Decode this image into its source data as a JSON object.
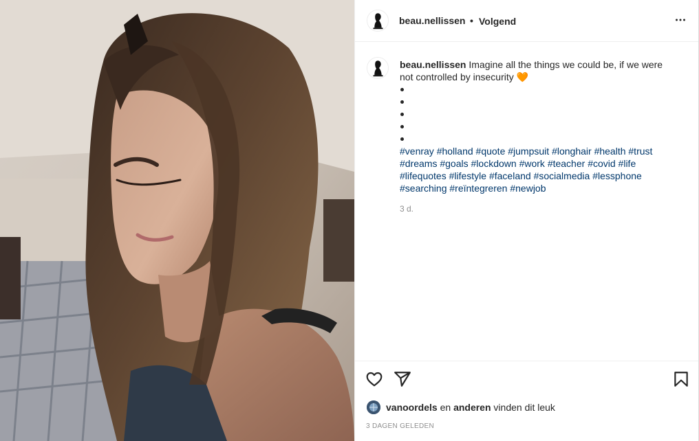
{
  "post": {
    "username": "beau.nellissen",
    "separator": "•",
    "follow_status": "Volgend",
    "photo_icon": "woman-portrait-photo"
  },
  "caption": {
    "username": "beau.nellissen",
    "text": " Imagine all the things we could be, if we were not controlled by insecurity ",
    "emoji": "🧡",
    "bullet_count": 5,
    "hashtags": [
      "#venray",
      "#holland",
      "#quote",
      "#jumpsuit",
      "#longhair",
      "#health",
      "#trust",
      "#dreams",
      "#goals",
      "#lockdown",
      "#work",
      "#teacher",
      "#covid",
      "#life",
      "#lifequotes",
      "#lifestyle",
      "#faceland",
      "#socialmedia",
      "#lessphone",
      "#searching",
      "#reïntegreren",
      "#newjob"
    ],
    "age": "3 d."
  },
  "actions": {
    "icons": [
      "heart-icon",
      "share-icon",
      "bookmark-icon",
      "more-options-icon"
    ]
  },
  "likes": {
    "user": "vanoordels",
    "conjunction": "en",
    "others": "anderen",
    "suffix": "vinden dit leuk"
  },
  "timestamp": "3 DAGEN GELEDEN",
  "colors": {
    "text": "#262626",
    "hashtag": "#00376b",
    "muted": "#8e8e8e",
    "divider": "#efefef"
  }
}
